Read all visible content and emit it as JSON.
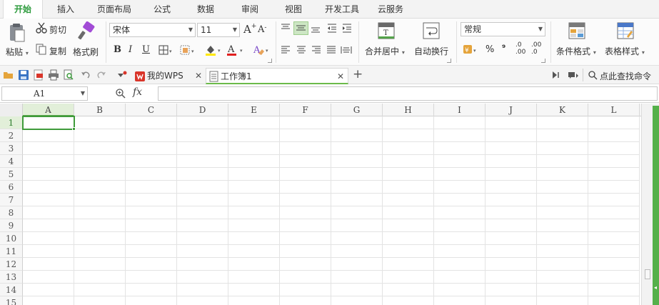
{
  "menu_tabs": [
    "开始",
    "插入",
    "页面布局",
    "公式",
    "数据",
    "审阅",
    "视图",
    "开发工具",
    "云服务"
  ],
  "ribbon": {
    "paste": "粘贴",
    "cut": "剪切",
    "copy": "复制",
    "format_painter": "格式刷",
    "font_name": "宋体",
    "font_size": "11",
    "merge_center": "合并居中",
    "wrap_text": "自动换行",
    "number_format": "常规",
    "percent": "%",
    "comma": "⁹",
    "dec_inc": ".0 .00",
    "dec_dec": ".00 .0",
    "conditional_format": "条件格式",
    "table_style": "表格样式",
    "bold": "B",
    "italic": "I",
    "underline": "U"
  },
  "doc_tabs": [
    {
      "label": "我的WPS",
      "active": false
    },
    {
      "label": "工作簿1",
      "active": true
    }
  ],
  "search_label": "点此查找命令",
  "name_box": "A1",
  "fx_label": "fx",
  "formula_value": "",
  "columns": [
    "A",
    "B",
    "C",
    "D",
    "E",
    "F",
    "G",
    "H",
    "I",
    "J",
    "K",
    "L"
  ],
  "rows": [
    "1",
    "2",
    "3",
    "4",
    "5",
    "6",
    "7",
    "8",
    "9",
    "10",
    "11",
    "12",
    "13",
    "14",
    "15"
  ],
  "active_cell": "A1",
  "colors": {
    "accent_green": "#2b9a3b",
    "selection_green": "#3f9b3a",
    "scroll_thumb": "#55b04a"
  }
}
